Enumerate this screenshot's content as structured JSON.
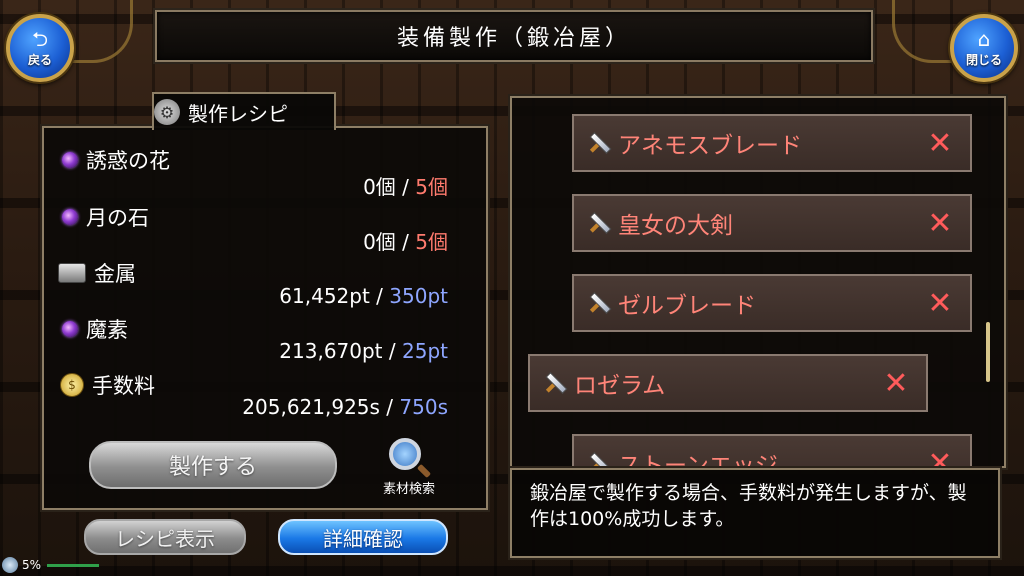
{
  "header": {
    "title": "装備製作（鍛冶屋）",
    "back_label": "戻る",
    "close_label": "閉じる"
  },
  "recipe": {
    "title": "製作レシピ",
    "items": [
      {
        "name": "誘惑の花",
        "have": "0個",
        "need": "5個",
        "icon": "purple-orb-icon",
        "need_color": "red"
      },
      {
        "name": "月の石",
        "have": "0個",
        "need": "5個",
        "icon": "purple-orb-icon",
        "need_color": "red"
      },
      {
        "name": "金属",
        "have": "61,452pt",
        "need": "350pt",
        "icon": "metal-ingot-icon",
        "need_color": "blue"
      },
      {
        "name": "魔素",
        "have": "213,670pt",
        "need": "25pt",
        "icon": "purple-orb-icon",
        "need_color": "blue"
      },
      {
        "name": "手数料",
        "have": "205,621,925s",
        "need": "750s",
        "icon": "coin-icon",
        "need_color": "blue"
      }
    ],
    "separator": "/",
    "craft_label": "製作する",
    "search_label": "素材検索"
  },
  "buttons": {
    "recipe_view": "レシピ表示",
    "detail_check": "詳細確認"
  },
  "equipment_list": [
    {
      "name": "アネモスブレード",
      "remove": "✕"
    },
    {
      "name": "皇女の大剣",
      "remove": "✕"
    },
    {
      "name": "ゼルブレード",
      "remove": "✕"
    },
    {
      "name": "ロゼラム",
      "remove": "✕"
    },
    {
      "name": "ストーンエッジ",
      "remove": "✕"
    }
  ],
  "message": "鍛冶屋で製作する場合、手数料が発生しますが、製作は100%成功します。",
  "status": {
    "percent": "5%"
  },
  "colors": {
    "need_red": "#ff7b6e",
    "need_blue": "#8ea6ff",
    "item_text": "#ff8478",
    "remove_x": "#ff5b5b"
  }
}
